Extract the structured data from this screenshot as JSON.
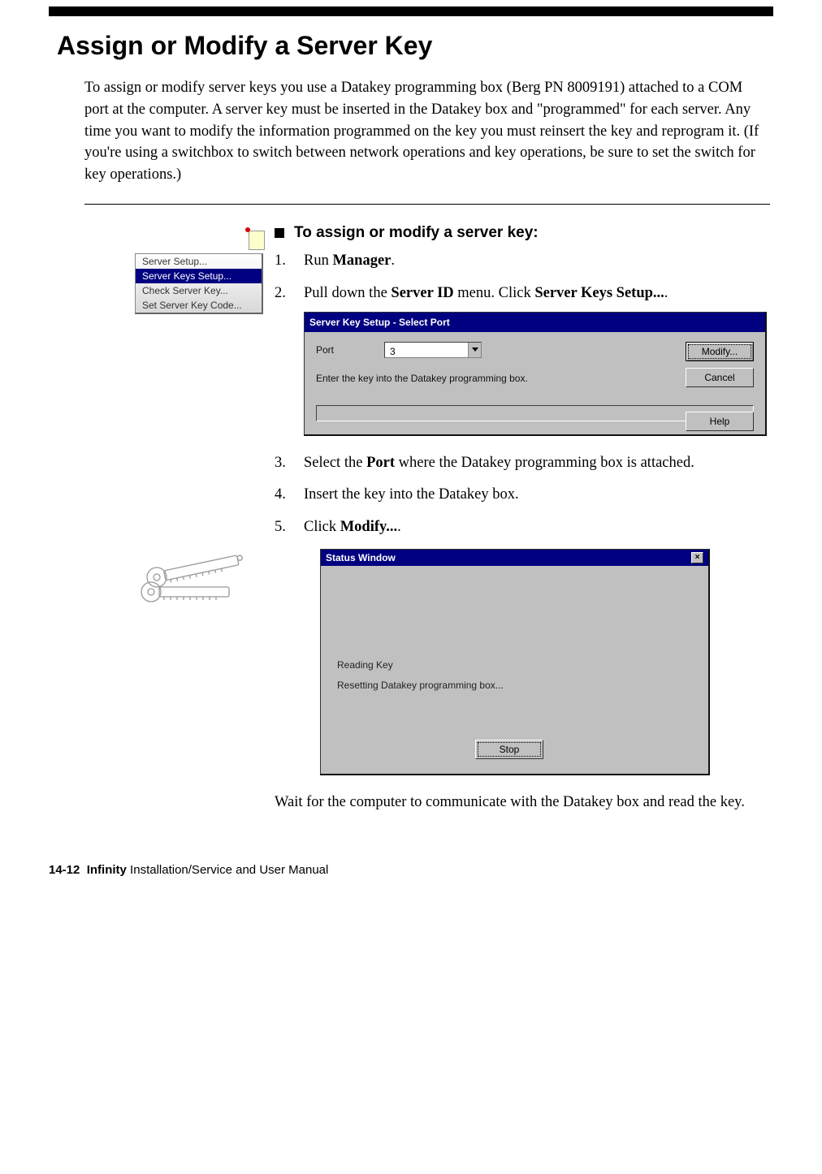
{
  "heading": "Assign or Modify a Server Key",
  "intro": "To assign or modify server keys you use a Datakey programming box (Berg PN 8009191) attached to a COM port at the computer. A server key must be inserted in the Datakey box and \"programmed\" for each server. Any time you want to modify the information programmed on the key you must reinsert the key and reprogram it. (If you're using a switchbox to switch between network operations and key operations, be sure to set the switch for key operations.)",
  "subhead": "To assign or modify a server key:",
  "menu": {
    "items": [
      {
        "label": "Server Setup..."
      },
      {
        "label": "Server Keys Setup...",
        "selected": true
      },
      {
        "label": "Check Server Key..."
      },
      {
        "label": "Set Server Key Code..."
      }
    ]
  },
  "steps": {
    "s1": {
      "pre": "Run ",
      "b": "Manager",
      "post": "."
    },
    "s2": {
      "pre": "Pull down the ",
      "b1": "Server ID",
      "mid": " menu. Click ",
      "b2": "Server Keys Setup...",
      "post": "."
    },
    "s3": {
      "pre": "Select the ",
      "b": "Port",
      "post": " where the Datakey programming box is attached."
    },
    "s4": {
      "text": "Insert the key into the Datakey box."
    },
    "s5": {
      "pre": "Click ",
      "b": "Modify...",
      "post": "."
    }
  },
  "dialog1": {
    "title": "Server Key Setup - Select Port",
    "port_label": "Port",
    "port_value": "3",
    "instruction": "Enter the key into the Datakey programming box.",
    "btn_modify": "Modify...",
    "btn_cancel": "Cancel",
    "btn_help": "Help"
  },
  "dialog2": {
    "title": "Status Window",
    "msg1": "Reading Key",
    "msg2": "Resetting Datakey programming box...",
    "btn_stop": "Stop"
  },
  "trail": "Wait for the computer to communicate with the Datakey box and read the key.",
  "footer": {
    "page": "14-12",
    "book_bold": "Infinity",
    "book_rest": " Installation/Service and User Manual"
  }
}
